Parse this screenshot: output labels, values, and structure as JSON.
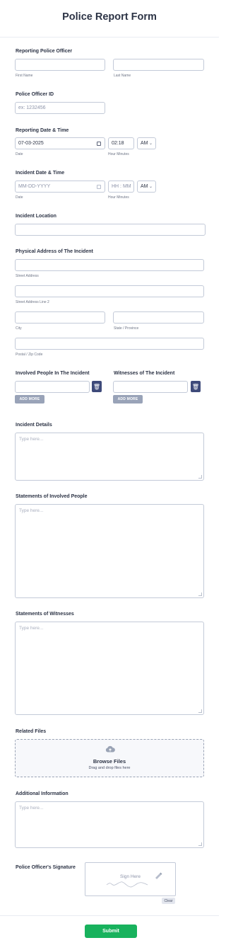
{
  "form": {
    "title": "Police Report Form"
  },
  "reporting_officer": {
    "label": "Reporting Police Officer",
    "first_sub": "First Name",
    "last_sub": "Last Name"
  },
  "officer_id": {
    "label": "Police Officer ID",
    "placeholder": "ex: 1232456"
  },
  "reporting_datetime": {
    "label": "Reporting Date & Time",
    "date_value": "07-03-2025",
    "date_sub": "Date",
    "time_value": "02:18",
    "ampm": "AM",
    "time_sub": "Hour Minutes"
  },
  "incident_datetime": {
    "label": "Incident Date & Time",
    "date_placeholder": "MM-DD-YYYY",
    "date_sub": "Date",
    "time_placeholder": "HH : MM",
    "ampm": "AM",
    "time_sub": "Hour Minutes"
  },
  "incident_location": {
    "label": "Incident Location"
  },
  "address": {
    "label": "Physical Address of The Incident",
    "street_sub": "Street Address",
    "street2_sub": "Street Address Line 2",
    "city_sub": "City",
    "state_sub": "State / Province",
    "zip_sub": "Postal / Zip Code"
  },
  "involved": {
    "label": "Involved People In The Incident",
    "add_label": "ADD MORE"
  },
  "witnesses": {
    "label": "Witnesses of The Incident",
    "add_label": "ADD MORE"
  },
  "incident_details": {
    "label": "Incident Details",
    "placeholder": "Type here..."
  },
  "statements_involved": {
    "label": "Statements of Involved People",
    "placeholder": "Type here..."
  },
  "statements_witnesses": {
    "label": "Statements of Witnesses",
    "placeholder": "Type here..."
  },
  "related_files": {
    "label": "Related Files",
    "browse": "Browse Files",
    "hint": "Drag and drop files here"
  },
  "additional_info": {
    "label": "Additional Information",
    "placeholder": "Type here..."
  },
  "signature": {
    "label": "Police Officer's Signature",
    "sign_here": "Sign Here",
    "clear": "Clear"
  },
  "submit": {
    "label": "Submit"
  },
  "colors": {
    "submit": "#18b25d",
    "trash": "#3e4a7a",
    "add_more": "#99a3b8"
  }
}
